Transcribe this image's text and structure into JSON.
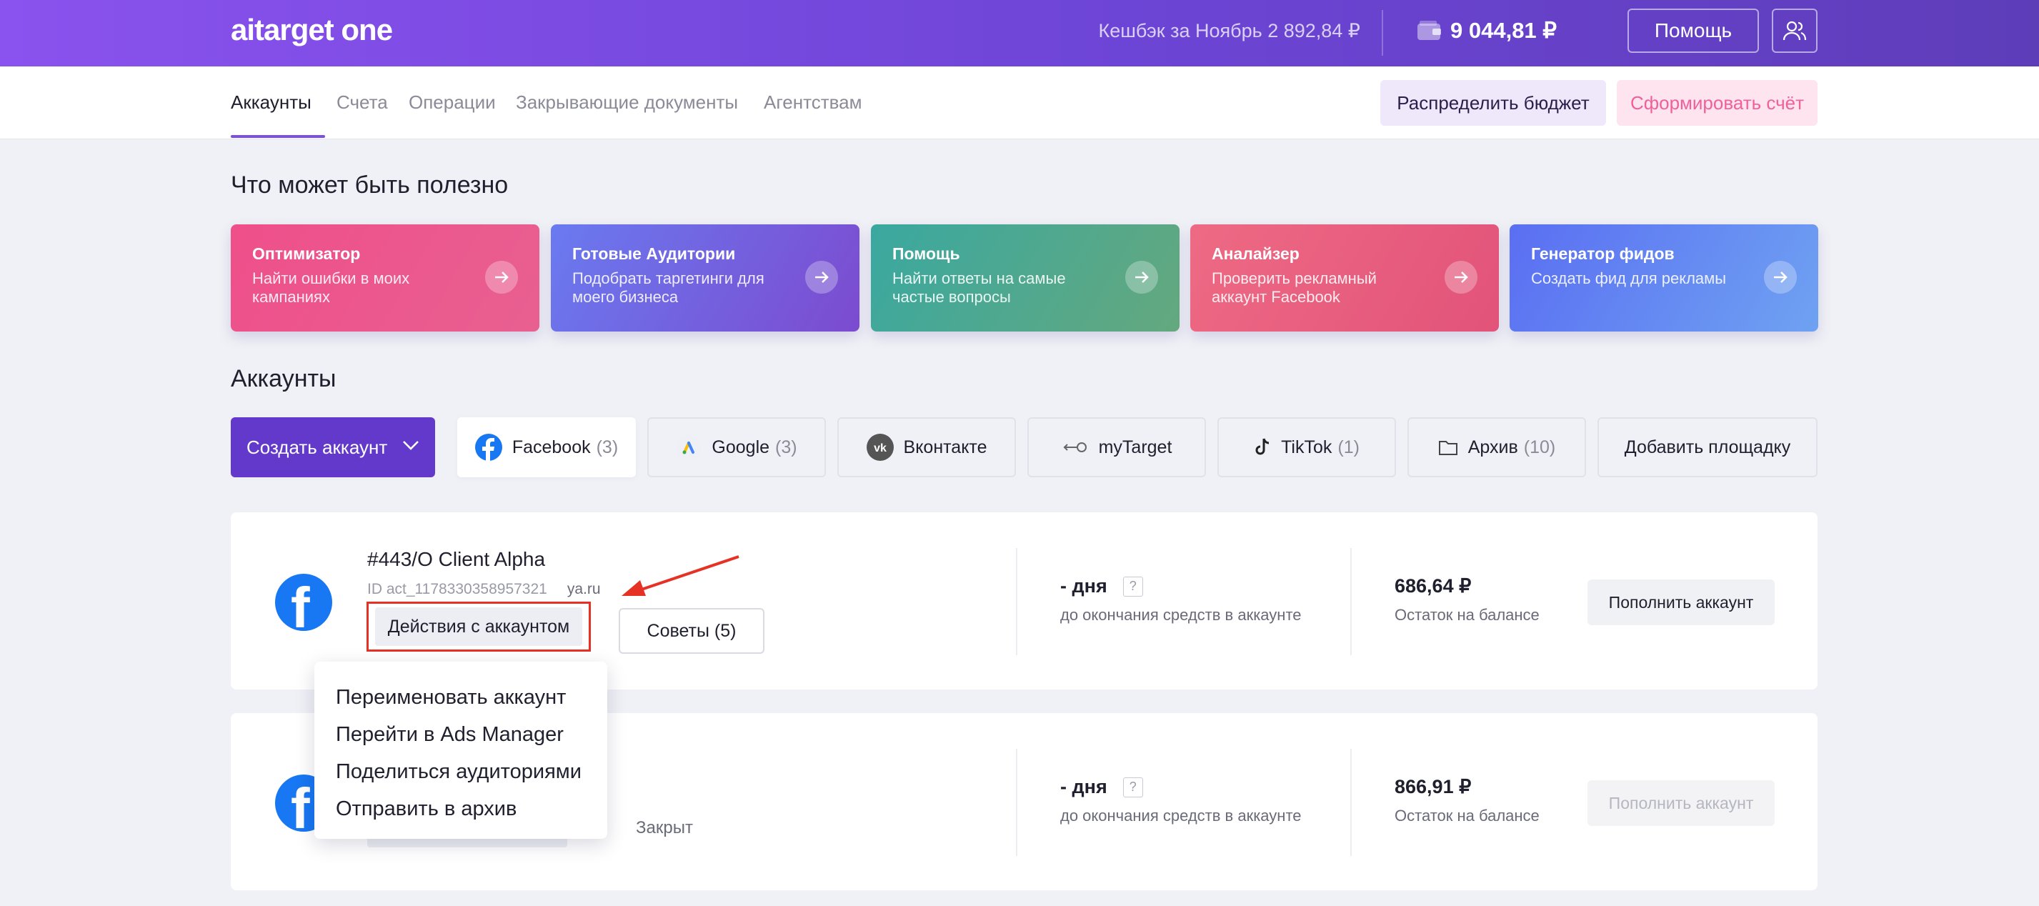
{
  "header": {
    "logo": "aitarget one",
    "cashback": "Кешбэк за Ноябрь 2 892,84 ₽",
    "balance": "9 044,81 ₽",
    "help_label": "Помощь",
    "user_icon": "users-icon",
    "wallet_icon": "wallet-icon"
  },
  "nav": {
    "tabs": [
      {
        "label": "Аккаунты",
        "active": true
      },
      {
        "label": "Счета",
        "active": false
      },
      {
        "label": "Операции",
        "active": false
      },
      {
        "label": "Закрывающие документы",
        "active": false
      },
      {
        "label": "Агентствам",
        "active": false
      }
    ],
    "distribute_label": "Распределить бюджет",
    "invoice_label": "Сформировать счёт"
  },
  "useful": {
    "title": "Что может быть полезно",
    "cards": [
      {
        "title": "Оптимизатор",
        "desc": "Найти ошибки в моих кампаниях",
        "gradient": [
          "#ef4f8a",
          "#e86090"
        ]
      },
      {
        "title": "Готовые Аудитории",
        "desc": "Подобрать таргетинги для моего бизнеса",
        "gradient": [
          "#6a7af0",
          "#7c4bcf"
        ]
      },
      {
        "title": "Помощь",
        "desc": "Найти ответы на самые частые вопросы",
        "gradient": [
          "#3aa8a0",
          "#64a87e"
        ]
      },
      {
        "title": "Аналайзер",
        "desc": "Проверить рекламный аккаунт Facebook",
        "gradient": [
          "#ee6a84",
          "#e2537a"
        ]
      },
      {
        "title": "Генератор фидов",
        "desc": "Создать фид для рекламы",
        "gradient": [
          "#5a6ef2",
          "#6fa2f2"
        ]
      }
    ]
  },
  "accounts": {
    "title": "Аккаунты",
    "create_label": "Создать аккаунт",
    "filters": [
      {
        "label": "Facebook",
        "count": "(3)",
        "icon": "facebook-icon",
        "active": true
      },
      {
        "label": "Google",
        "count": "(3)",
        "icon": "google-ads-icon",
        "active": false
      },
      {
        "label": "Вконтакте",
        "count": "",
        "icon": "vk-icon",
        "active": false
      },
      {
        "label": "myTarget",
        "count": "",
        "icon": "mytarget-icon",
        "active": false
      },
      {
        "label": "TikTok",
        "count": "(1)",
        "icon": "tiktok-icon",
        "active": false
      },
      {
        "label": "Архив",
        "count": "(10)",
        "icon": "folder-icon",
        "active": false
      },
      {
        "label": "Добавить площадку",
        "count": "",
        "icon": "",
        "active": false
      }
    ],
    "list": [
      {
        "name": "#443/O Client Alpha",
        "id": "ID act_1178330358957321",
        "domain": "ya.ru",
        "actions_label": "Действия с аккаунтом",
        "tips_label": "Советы (5)",
        "days": "- дня",
        "days_help": "?",
        "days_label": "до окончания средств в аккаунте",
        "amount": "686,64 ₽",
        "amount_label": "Остаток на балансе",
        "topup_label": "Пополнить аккаунт"
      },
      {
        "status": "Закрыт",
        "days": "- дня",
        "days_help": "?",
        "days_label": "до окончания средств в аккаунте",
        "amount": "866,91 ₽",
        "amount_label": "Остаток на балансе",
        "topup_label": "Пополнить аккаунт"
      }
    ]
  },
  "dropdown": {
    "items": [
      "Переименовать аккаунт",
      "Перейти в Ads Manager",
      "Поделиться аудиториями",
      "Отправить в архив"
    ]
  }
}
